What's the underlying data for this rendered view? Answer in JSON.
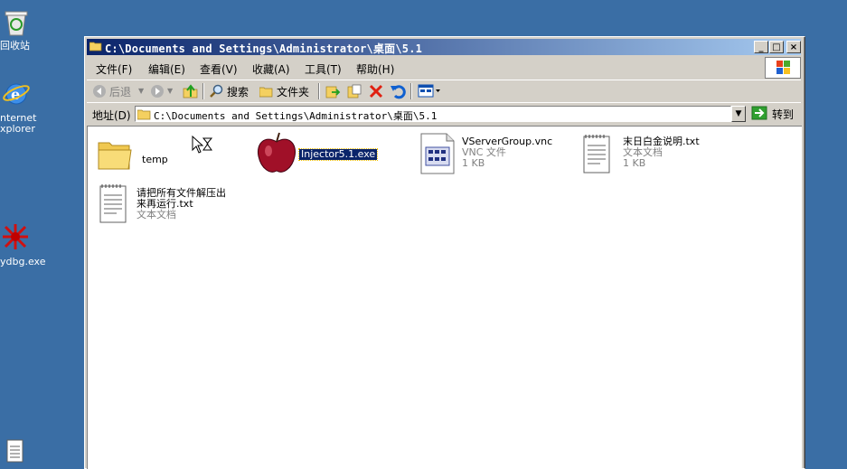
{
  "desktop": {
    "icons": [
      {
        "label": "回收站"
      },
      {
        "label_line1": "nternet",
        "label_line2": "xplorer"
      },
      {
        "label": "ydbg.exe"
      }
    ]
  },
  "window": {
    "title": "C:\\Documents and Settings\\Administrator\\桌面\\5.1",
    "controls": {
      "minimize": "_",
      "maximize": "□",
      "close": "×"
    }
  },
  "menu": [
    "文件(F)",
    "编辑(E)",
    "查看(V)",
    "收藏(A)",
    "工具(T)",
    "帮助(H)"
  ],
  "toolbar": {
    "back": "后退",
    "search": "搜索",
    "folders": "文件夹"
  },
  "address": {
    "label": "地址(D)",
    "value": "C:\\Documents and Settings\\Administrator\\桌面\\5.1",
    "go": "转到"
  },
  "files": [
    {
      "name": "temp",
      "icon": "folder-icon"
    },
    {
      "name": "Injector5.1.exe",
      "icon": "apple-exe-icon",
      "selected": true
    },
    {
      "name": "VServerGroup.vnc",
      "type": "VNC 文件",
      "size": "1 KB",
      "icon": "vnc-file-icon"
    },
    {
      "name": "末日白金说明.txt",
      "type": "文本文档",
      "size": "1 KB",
      "icon": "text-file-icon"
    },
    {
      "name_line1": "请把所有文件解压出",
      "name_line2": "来再运行.txt",
      "type": "文本文档",
      "icon": "text-file-icon"
    }
  ],
  "colors": {
    "desktop": "#3a6ea5",
    "titlebar_start": "#0a246a",
    "titlebar_end": "#a6caf0",
    "window_face": "#d4d0c8"
  }
}
